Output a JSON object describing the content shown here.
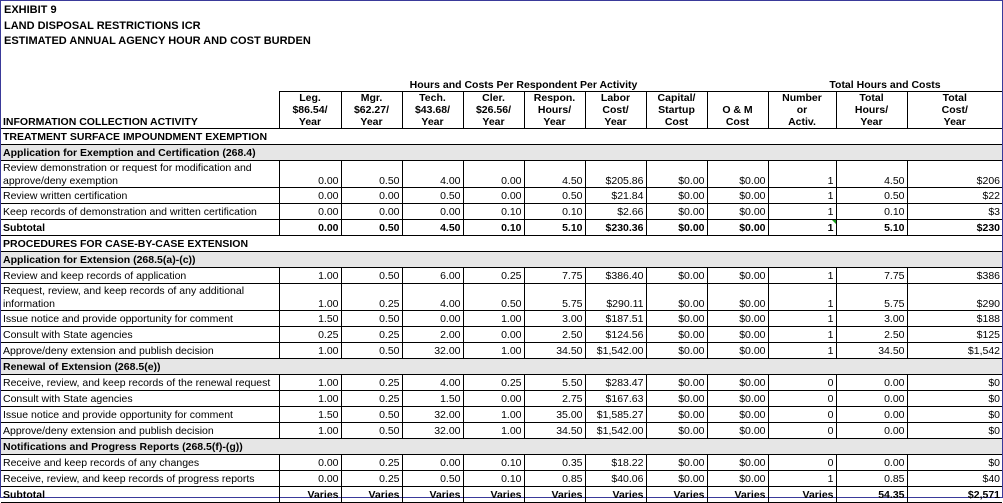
{
  "title": {
    "line1": "EXHIBIT 9",
    "line2": "LAND DISPOSAL RESTRICTIONS ICR",
    "line3": "ESTIMATED ANNUAL AGENCY HOUR AND COST BURDEN"
  },
  "headers": {
    "group_per_activity": "Hours and Costs Per Respondent Per Activity",
    "group_totals": "Total Hours and Costs",
    "activity": "INFORMATION COLLECTION ACTIVITY",
    "columns": [
      [
        "Leg.",
        "$86.54/",
        "Year"
      ],
      [
        "Mgr.",
        "$62.27/",
        "Year"
      ],
      [
        "Tech.",
        "$43.68/",
        "Year"
      ],
      [
        "Cler.",
        "$26.56/",
        "Year"
      ],
      [
        "Respon.",
        "Hours/",
        "Year"
      ],
      [
        "Labor",
        "Cost/",
        "Year"
      ],
      [
        "Capital/",
        "Startup",
        "Cost"
      ],
      [
        "",
        "O & M",
        "Cost"
      ],
      [
        "Number",
        "or",
        "Activ."
      ],
      [
        "Total",
        "Hours/",
        "Year"
      ],
      [
        "Total",
        "Cost/",
        "Year"
      ]
    ]
  },
  "rows": [
    {
      "type": "section",
      "label": "TREATMENT SURFACE IMPOUNDMENT EXEMPTION"
    },
    {
      "type": "sub",
      "label": "Application for Exemption and Certification (268.4)"
    },
    {
      "type": "data",
      "tall": true,
      "label": "Review demonstration or request for modification and approve/deny exemption",
      "v": [
        "0.00",
        "0.50",
        "4.00",
        "0.00",
        "4.50",
        "$205.86",
        "$0.00",
        "$0.00",
        "1",
        "4.50",
        "$206"
      ]
    },
    {
      "type": "data",
      "label": "Review written certification",
      "v": [
        "0.00",
        "0.00",
        "0.50",
        "0.00",
        "0.50",
        "$21.84",
        "$0.00",
        "$0.00",
        "1",
        "0.50",
        "$22"
      ]
    },
    {
      "type": "data",
      "label": "Keep records of demonstration and written certification",
      "v": [
        "0.00",
        "0.00",
        "0.00",
        "0.10",
        "0.10",
        "$2.66",
        "$0.00",
        "$0.00",
        "1",
        "0.10",
        "$3"
      ]
    },
    {
      "type": "total",
      "label": "Subtotal",
      "v": [
        "0.00",
        "0.50",
        "4.50",
        "0.10",
        "5.10",
        "$230.36",
        "$0.00",
        "$0.00",
        "1",
        "5.10",
        "$230"
      ]
    },
    {
      "type": "section",
      "label": "PROCEDURES FOR CASE-BY-CASE EXTENSION"
    },
    {
      "type": "sub",
      "label": "Application for Extension (268.5(a)-(c))"
    },
    {
      "type": "data",
      "label": "Review and keep records of application",
      "v": [
        "1.00",
        "0.50",
        "6.00",
        "0.25",
        "7.75",
        "$386.40",
        "$0.00",
        "$0.00",
        "1",
        "7.75",
        "$386"
      ]
    },
    {
      "type": "data",
      "tall": true,
      "label": "Request, review, and keep records of any additional information",
      "v": [
        "1.00",
        "0.25",
        "4.00",
        "0.50",
        "5.75",
        "$290.11",
        "$0.00",
        "$0.00",
        "1",
        "5.75",
        "$290"
      ]
    },
    {
      "type": "data",
      "label": "Issue notice and provide opportunity for comment",
      "v": [
        "1.50",
        "0.50",
        "0.00",
        "1.00",
        "3.00",
        "$187.51",
        "$0.00",
        "$0.00",
        "1",
        "3.00",
        "$188"
      ]
    },
    {
      "type": "data",
      "label": "Consult with State agencies",
      "v": [
        "0.25",
        "0.25",
        "2.00",
        "0.00",
        "2.50",
        "$124.56",
        "$0.00",
        "$0.00",
        "1",
        "2.50",
        "$125"
      ]
    },
    {
      "type": "data",
      "label": "Approve/deny extension and publish decision",
      "v": [
        "1.00",
        "0.50",
        "32.00",
        "1.00",
        "34.50",
        "$1,542.00",
        "$0.00",
        "$0.00",
        "1",
        "34.50",
        "$1,542"
      ]
    },
    {
      "type": "sub",
      "label": "Renewal of Extension (268.5(e))"
    },
    {
      "type": "data",
      "label": "Receive, review, and keep records of the renewal request",
      "v": [
        "1.00",
        "0.25",
        "4.00",
        "0.25",
        "5.50",
        "$283.47",
        "$0.00",
        "$0.00",
        "0",
        "0.00",
        "$0"
      ]
    },
    {
      "type": "data",
      "label": "Consult with State agencies",
      "v": [
        "1.00",
        "0.25",
        "1.50",
        "0.00",
        "2.75",
        "$167.63",
        "$0.00",
        "$0.00",
        "0",
        "0.00",
        "$0"
      ]
    },
    {
      "type": "data",
      "label": "Issue notice and provide opportunity for comment",
      "v": [
        "1.50",
        "0.50",
        "32.00",
        "1.00",
        "35.00",
        "$1,585.27",
        "$0.00",
        "$0.00",
        "0",
        "0.00",
        "$0"
      ]
    },
    {
      "type": "data",
      "label": "Approve/deny extension and publish decision",
      "v": [
        "1.00",
        "0.50",
        "32.00",
        "1.00",
        "34.50",
        "$1,542.00",
        "$0.00",
        "$0.00",
        "0",
        "0.00",
        "$0"
      ]
    },
    {
      "type": "sub",
      "label": "Notifications and Progress Reports (268.5(f)-(g))"
    },
    {
      "type": "data",
      "label": "Receive and keep records of any changes",
      "v": [
        "0.00",
        "0.25",
        "0.00",
        "0.10",
        "0.35",
        "$18.22",
        "$0.00",
        "$0.00",
        "0",
        "0.00",
        "$0"
      ]
    },
    {
      "type": "data",
      "label": "Receive, review, and keep records of progress reports",
      "v": [
        "0.00",
        "0.25",
        "0.50",
        "0.10",
        "0.85",
        "$40.06",
        "$0.00",
        "$0.00",
        "1",
        "0.85",
        "$40"
      ]
    },
    {
      "type": "total",
      "label": "Subtotal",
      "v": [
        "Varies",
        "Varies",
        "Varies",
        "Varies",
        "Varies",
        "Varies",
        "Varies",
        "Varies",
        "Varies",
        "54.35",
        "$2,571"
      ]
    }
  ]
}
